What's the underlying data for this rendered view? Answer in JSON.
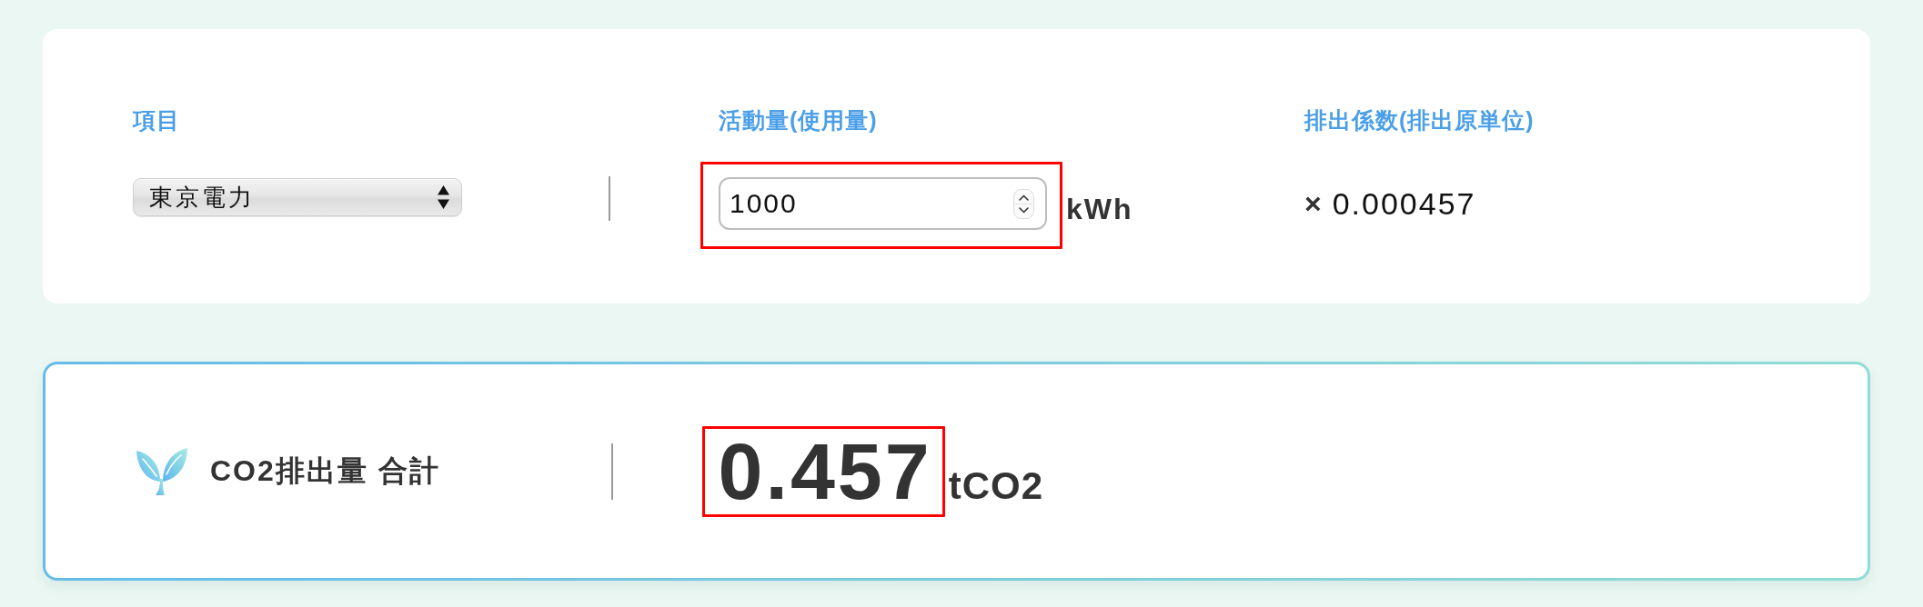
{
  "calculator": {
    "item": {
      "header": "項目",
      "select": {
        "value": "東京電力"
      }
    },
    "activity": {
      "header": "活動量(使用量)",
      "input": {
        "value": "1000",
        "highlighted": true
      },
      "unit": "kWh"
    },
    "factor": {
      "header": "排出係数(排出原単位)",
      "symbol": "×",
      "value": "0.000457"
    }
  },
  "total": {
    "label": "CO2排出量 合計",
    "value": "0.457",
    "unit": "tCO2",
    "highlighted": true
  }
}
